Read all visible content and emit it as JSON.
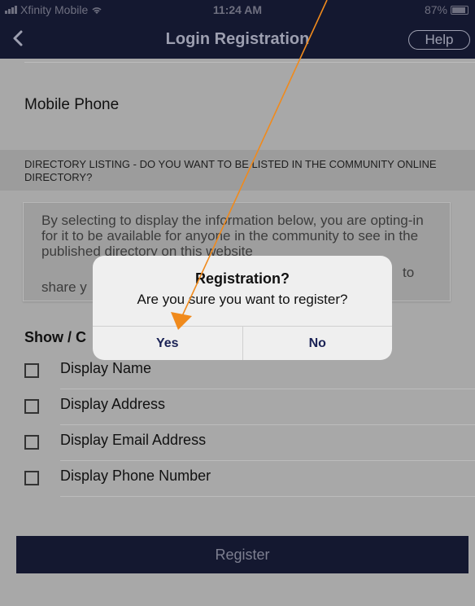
{
  "status_bar": {
    "carrier": "Xfinity Mobile",
    "time": "11:24 AM",
    "battery": "87%"
  },
  "nav": {
    "title": "Login Registration",
    "help_label": "Help",
    "back_icon": "chevron-left-icon"
  },
  "form": {
    "mobile_phone_label": "Mobile Phone"
  },
  "directory": {
    "header": "DIRECTORY LISTING - DO YOU WANT TO BE LISTED IN THE COMMUNITY ONLINE DIRECTORY?",
    "info_visible_text": "By selecting to display the information below, you are opting-in for it to be available for anyone in the community to see in the published directory on this website",
    "info_text_tail": "to",
    "info_text_line5": "share y"
  },
  "options": {
    "title_visible": "Show / C",
    "items": [
      {
        "label": "Display Name",
        "checked": false
      },
      {
        "label": "Display Address",
        "checked": false
      },
      {
        "label": "Display Email Address",
        "checked": false
      },
      {
        "label": "Display Phone Number",
        "checked": false
      }
    ]
  },
  "register_label": "Register",
  "alert": {
    "title": "Registration?",
    "message": "Are you sure you want to register?",
    "yes_label": "Yes",
    "no_label": "No"
  },
  "colors": {
    "navy": "#141830",
    "annotation_orange": "#f08a1c",
    "dim_overlay_bg": "#a8a8a8"
  }
}
